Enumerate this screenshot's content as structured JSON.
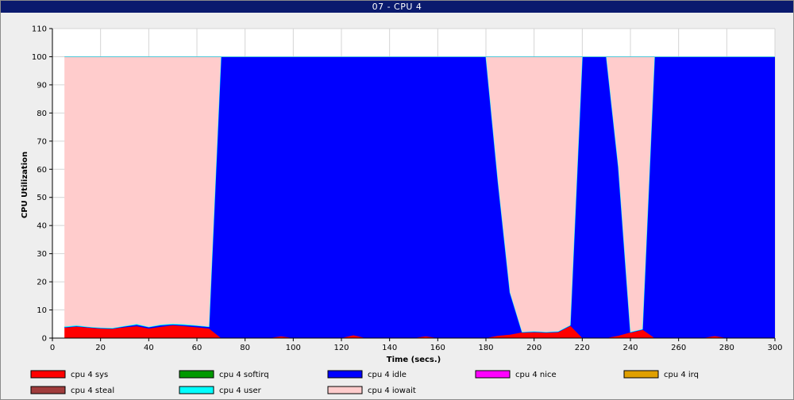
{
  "window": {
    "title": "07 - CPU 4"
  },
  "chart_data": {
    "type": "area",
    "xlabel": "Time (secs.)",
    "ylabel": "CPU Utilization",
    "xlim": [
      0,
      300
    ],
    "ylim": [
      0,
      110
    ],
    "x_ticks": [
      0,
      20,
      40,
      60,
      80,
      100,
      120,
      140,
      160,
      180,
      200,
      220,
      240,
      260,
      280,
      300
    ],
    "y_ticks": [
      0,
      10,
      20,
      30,
      40,
      50,
      60,
      70,
      80,
      90,
      100,
      110
    ],
    "grid": true,
    "legend_placement": "bottom",
    "x": [
      5,
      10,
      15,
      20,
      25,
      30,
      35,
      40,
      45,
      50,
      55,
      60,
      65,
      70,
      75,
      80,
      85,
      90,
      95,
      100,
      105,
      110,
      115,
      120,
      125,
      130,
      135,
      140,
      145,
      150,
      155,
      160,
      165,
      170,
      175,
      180,
      185,
      190,
      195,
      200,
      205,
      210,
      215,
      220,
      225,
      230,
      235,
      240,
      245,
      250,
      255,
      260,
      265,
      270,
      275,
      280,
      285,
      290,
      295,
      300
    ],
    "series": [
      {
        "name": "cpu 4 sys",
        "color": "#ff0000",
        "values": [
          3.8,
          4.2,
          3.8,
          3.5,
          3.4,
          3.8,
          4.2,
          3.4,
          4.0,
          4.5,
          4.2,
          3.8,
          3.4,
          0,
          0,
          0,
          0,
          0,
          0.6,
          0,
          0,
          0,
          0,
          0,
          1.0,
          0,
          0,
          0,
          0,
          0,
          0.6,
          0,
          0,
          0,
          0,
          0,
          0.8,
          1.2,
          2.0,
          2.2,
          2.0,
          2.2,
          4.4,
          0,
          0,
          0,
          0.8,
          2.0,
          3.0,
          0,
          0,
          0,
          0,
          0,
          0.7,
          0,
          0,
          0,
          0,
          0
        ]
      },
      {
        "name": "cpu 4 softirq",
        "color": "#009900",
        "values": [
          0,
          0,
          0,
          0,
          0,
          0,
          0,
          0,
          0,
          0,
          0,
          0,
          0,
          0,
          0,
          0,
          0,
          0,
          0,
          0,
          0,
          0,
          0,
          0,
          0,
          0,
          0,
          0,
          0,
          0,
          0,
          0,
          0,
          0,
          0,
          0,
          0,
          0,
          0,
          0,
          0,
          0,
          0,
          0,
          0,
          0,
          0,
          0,
          0,
          0,
          0,
          0,
          0,
          0,
          0,
          0,
          0,
          0,
          0,
          0
        ]
      },
      {
        "name": "cpu 4 idle",
        "color": "#0000ff",
        "values": [
          0,
          0,
          0,
          0,
          0,
          0.3,
          0.5,
          0.4,
          0.5,
          0.3,
          0.4,
          0.5,
          0.5,
          100,
          100,
          100,
          100,
          100,
          99.4,
          100,
          100,
          100,
          100,
          100,
          99,
          100,
          100,
          100,
          100,
          100,
          99.4,
          100,
          100,
          100,
          100,
          100,
          55,
          15,
          0,
          0,
          0,
          0,
          0,
          100,
          100,
          100,
          60,
          0,
          0,
          100,
          100,
          100,
          100,
          100,
          99.3,
          100,
          100,
          100,
          100,
          100
        ]
      },
      {
        "name": "cpu 4 nice",
        "color": "#ff00ff",
        "values": [
          0,
          0,
          0,
          0,
          0,
          0,
          0,
          0,
          0,
          0,
          0,
          0,
          0,
          0,
          0,
          0,
          0,
          0,
          0,
          0,
          0,
          0,
          0,
          0,
          0,
          0,
          0,
          0,
          0,
          0,
          0,
          0,
          0,
          0,
          0,
          0,
          0,
          0,
          0,
          0,
          0,
          0,
          0,
          0,
          0,
          0,
          0,
          0,
          0,
          0,
          0,
          0,
          0,
          0,
          0,
          0,
          0,
          0,
          0,
          0
        ]
      },
      {
        "name": "cpu 4 irq",
        "color": "#e0a000",
        "values": [
          0,
          0,
          0,
          0,
          0,
          0,
          0,
          0,
          0,
          0,
          0,
          0,
          0,
          0,
          0,
          0,
          0,
          0,
          0,
          0,
          0,
          0,
          0,
          0,
          0,
          0,
          0,
          0,
          0,
          0,
          0,
          0,
          0,
          0,
          0,
          0,
          0,
          0,
          0,
          0,
          0,
          0,
          0,
          0,
          0,
          0,
          0,
          0,
          0,
          0,
          0,
          0,
          0,
          0,
          0,
          0,
          0,
          0,
          0,
          0
        ]
      },
      {
        "name": "cpu 4 steal",
        "color": "#a03c3c",
        "values": [
          0,
          0,
          0,
          0,
          0,
          0,
          0,
          0,
          0,
          0,
          0,
          0,
          0,
          0,
          0,
          0,
          0,
          0,
          0,
          0,
          0,
          0,
          0,
          0,
          0,
          0,
          0,
          0,
          0,
          0,
          0,
          0,
          0,
          0,
          0,
          0,
          0,
          0,
          0,
          0,
          0,
          0,
          0,
          0,
          0,
          0,
          0,
          0,
          0,
          0,
          0,
          0,
          0,
          0,
          0,
          0,
          0,
          0,
          0,
          0
        ]
      },
      {
        "name": "cpu 4 user",
        "color": "#00ffff",
        "values": [
          0.3,
          0.3,
          0.2,
          0.2,
          0.2,
          0.2,
          0.3,
          0.2,
          0.3,
          0.3,
          0.3,
          0.2,
          0.2,
          0,
          0,
          0,
          0,
          0,
          0,
          0,
          0,
          0,
          0,
          0,
          0,
          0,
          0,
          0,
          0,
          0,
          0,
          0,
          0,
          0,
          0,
          0,
          0,
          0,
          0.2,
          0.2,
          0.2,
          0.2,
          0.2,
          0,
          0,
          0,
          0,
          0.2,
          0.2,
          0,
          0,
          0,
          0,
          0,
          0,
          0,
          0,
          0,
          0,
          0
        ]
      },
      {
        "name": "cpu 4 iowait",
        "color": "#ffcccc",
        "values": [
          95.9,
          95.5,
          96.0,
          96.3,
          96.4,
          95.7,
          95.0,
          96.0,
          95.2,
          94.9,
          95.1,
          95.5,
          95.9,
          0,
          0,
          0,
          0,
          0,
          0,
          0,
          0,
          0,
          0,
          0,
          0,
          0,
          0,
          0,
          0,
          0,
          0,
          0,
          0,
          0,
          0,
          0,
          44.2,
          83.8,
          97.8,
          97.6,
          97.8,
          97.6,
          95.4,
          0,
          0,
          0,
          39.2,
          97.8,
          96.8,
          0,
          0,
          0,
          0,
          0,
          0,
          0,
          0,
          0,
          0,
          0
        ]
      }
    ]
  }
}
